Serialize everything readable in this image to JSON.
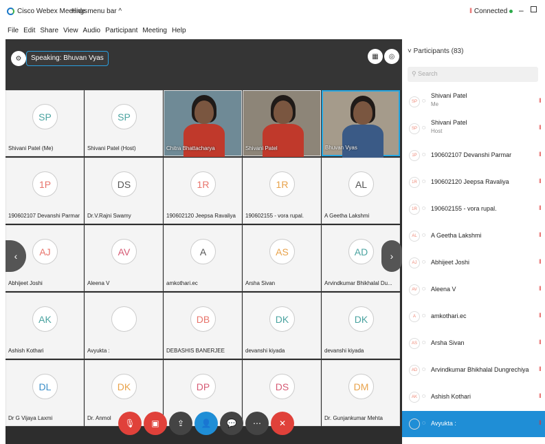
{
  "titlebar": {
    "app_title": "Cisco Webex Meetings",
    "hide_menu": "Hide menu bar ^",
    "connected": "Connected",
    "minimize": "–"
  },
  "menu": [
    "File",
    "Edit",
    "Share",
    "View",
    "Audio",
    "Participant",
    "Meeting",
    "Help"
  ],
  "stage": {
    "speaking": "Speaking: Bhuvan Vyas",
    "prev": "‹",
    "next": "›"
  },
  "tiles": [
    {
      "initials": "SP",
      "name": "Shivani Patel (Me)",
      "color": "#4aa3a0"
    },
    {
      "initials": "SP",
      "name": "Shivani Patel (Host)",
      "color": "#4aa3a0"
    },
    {
      "video": true,
      "name": "Chitra Bhattacharya"
    },
    {
      "video": true,
      "name": "Shivani Patel"
    },
    {
      "video": true,
      "name": "Bhuvan Vyas",
      "active": true
    },
    {
      "initials": "1P",
      "name": "190602107 Devanshi Parmar",
      "color": "#e8746b"
    },
    {
      "initials": "DS",
      "name": "Dr.V.Rajni Swamy",
      "color": "#555"
    },
    {
      "initials": "1R",
      "name": "190602120 Jeepsa Ravaliya",
      "color": "#e8746b"
    },
    {
      "initials": "1R",
      "name": "190602155 - vora rupal.",
      "color": "#e8a24a"
    },
    {
      "initials": "AL",
      "name": "A Geetha Lakshmi",
      "color": "#555"
    },
    {
      "initials": "AJ",
      "name": "Abhijeet Joshi",
      "color": "#e8746b"
    },
    {
      "initials": "AV",
      "name": "Aleena V",
      "color": "#d65a74"
    },
    {
      "initials": "A",
      "name": "amkothari.ec",
      "color": "#555"
    },
    {
      "initials": "AS",
      "name": "Arsha Sivan",
      "color": "#e8a24a"
    },
    {
      "initials": "AD",
      "name": "Arvindkumar Bhikhalal Du...",
      "color": "#4aa3a0"
    },
    {
      "initials": "AK",
      "name": "Ashish Kothari",
      "color": "#4aa3a0"
    },
    {
      "initials": "",
      "name": "Avyukta :",
      "color": "#aaa"
    },
    {
      "initials": "DB",
      "name": "DEBASHIS BANERJEE",
      "color": "#e8746b"
    },
    {
      "initials": "DK",
      "name": "devanshi kiyada",
      "color": "#4aa3a0"
    },
    {
      "initials": "DK",
      "name": "devanshi kiyada",
      "color": "#4aa3a0"
    },
    {
      "initials": "DL",
      "name": "Dr G Vijaya Laxmi",
      "color": "#3a8ec8"
    },
    {
      "initials": "DK",
      "name": "Dr. Anmol",
      "color": "#e8a24a"
    },
    {
      "initials": "DP",
      "name": "",
      "color": "#d65a74"
    },
    {
      "initials": "DS",
      "name": "",
      "color": "#d65a74"
    },
    {
      "initials": "DM",
      "name": "Dr. Gunjankumar Mehta",
      "color": "#e8a24a"
    }
  ],
  "panel": {
    "title": "Participants (83)",
    "search_placeholder": "Search",
    "rows": [
      {
        "av": "SP",
        "name": "Shivani Patel",
        "sub": "Me"
      },
      {
        "av": "SP",
        "name": "Shivani Patel",
        "sub": "Host"
      },
      {
        "av": "1P",
        "name": "190602107 Devanshi Parmar"
      },
      {
        "av": "1R",
        "name": "190602120 Jeepsa Ravaliya"
      },
      {
        "av": "1R",
        "name": "190602155 - vora rupal."
      },
      {
        "av": "AL",
        "name": "A Geetha Lakshmi"
      },
      {
        "av": "AJ",
        "name": "Abhijeet Joshi"
      },
      {
        "av": "AV",
        "name": "Aleena V"
      },
      {
        "av": "A",
        "name": "amkothari.ec"
      },
      {
        "av": "AS",
        "name": "Arsha Sivan"
      },
      {
        "av": "AD",
        "name": "Arvindkumar Bhikhalal Dungrechiya"
      },
      {
        "av": "AK",
        "name": "Ashish Kothari"
      },
      {
        "av": "",
        "name": "Avyukta :",
        "selected": true
      }
    ]
  }
}
